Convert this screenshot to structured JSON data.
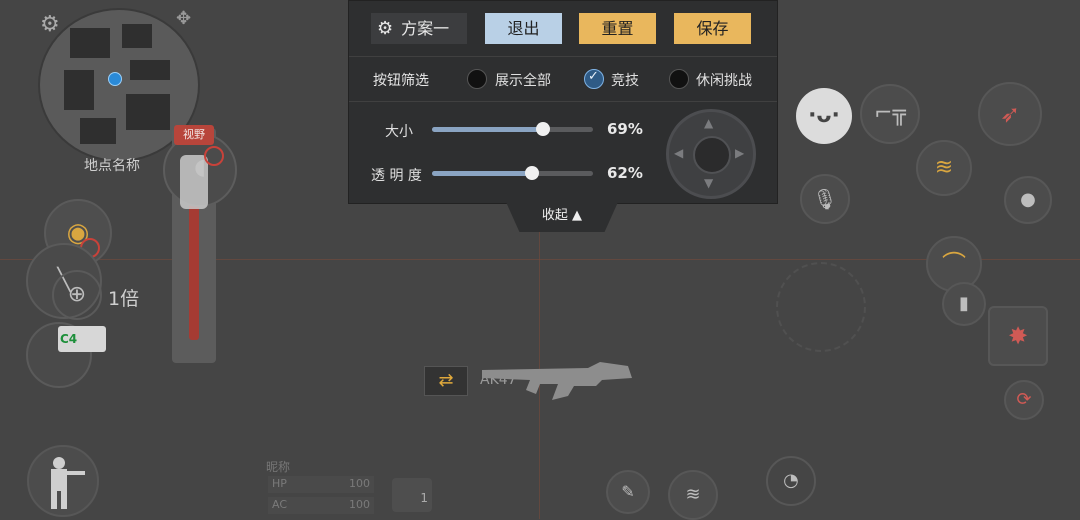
{
  "top_panel": {
    "scheme_label": "方案一",
    "exit_label": "退出",
    "reset_label": "重置",
    "save_label": "保存",
    "filter_title": "按钮筛选",
    "filters": [
      {
        "label": "展示全部",
        "selected": false
      },
      {
        "label": "竞技",
        "selected": true
      },
      {
        "label": "休闲挑战",
        "selected": false
      }
    ],
    "size_label": "大小",
    "size_value_text": "69%",
    "size_value": 0.69,
    "opacity_label": "透 明 度",
    "opacity_value_text": "62%",
    "opacity_value": 0.62,
    "collapse_label": "收起 ▲"
  },
  "minimap": {
    "place_name": "地点名称"
  },
  "zoom": {
    "badge": "视野",
    "level_text": "1倍"
  },
  "ammo_card": "C4",
  "weapon": {
    "name": "AK47"
  },
  "status": {
    "nickname_label": "昵称",
    "hp_label": "HP",
    "hp_value": "100",
    "ac_label": "AC",
    "ac_value": "100",
    "pack_count": "1"
  },
  "colors": {
    "accent_blue": "#b9d0e6",
    "accent_orange": "#e9b75d",
    "zoom_red": "#a53b33"
  }
}
